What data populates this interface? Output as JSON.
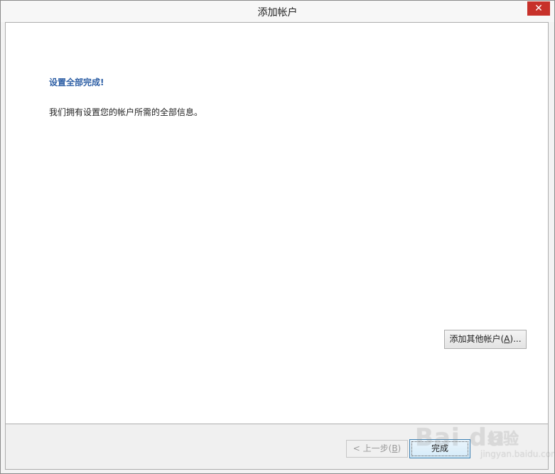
{
  "window": {
    "title": "添加帐户",
    "close_symbol": "✕"
  },
  "content": {
    "heading": "设置全部完成!",
    "description": "我们拥有设置您的帐户所需的全部信息。",
    "add_other_button": {
      "prefix": "添加其他帐户(",
      "mnemonic": "A",
      "suffix": ")..."
    }
  },
  "footer": {
    "back_button": {
      "prefix": "< 上一步(",
      "mnemonic": "B",
      "suffix": ")"
    },
    "finish_label": "完成"
  },
  "watermark": {
    "logo": "Bai du",
    "cn": "经验",
    "url": "jingyan.baidu.com"
  },
  "colors": {
    "close_bg": "#c7312a",
    "heading": "#2e5fa5",
    "finish_border": "#3c7fb1"
  }
}
